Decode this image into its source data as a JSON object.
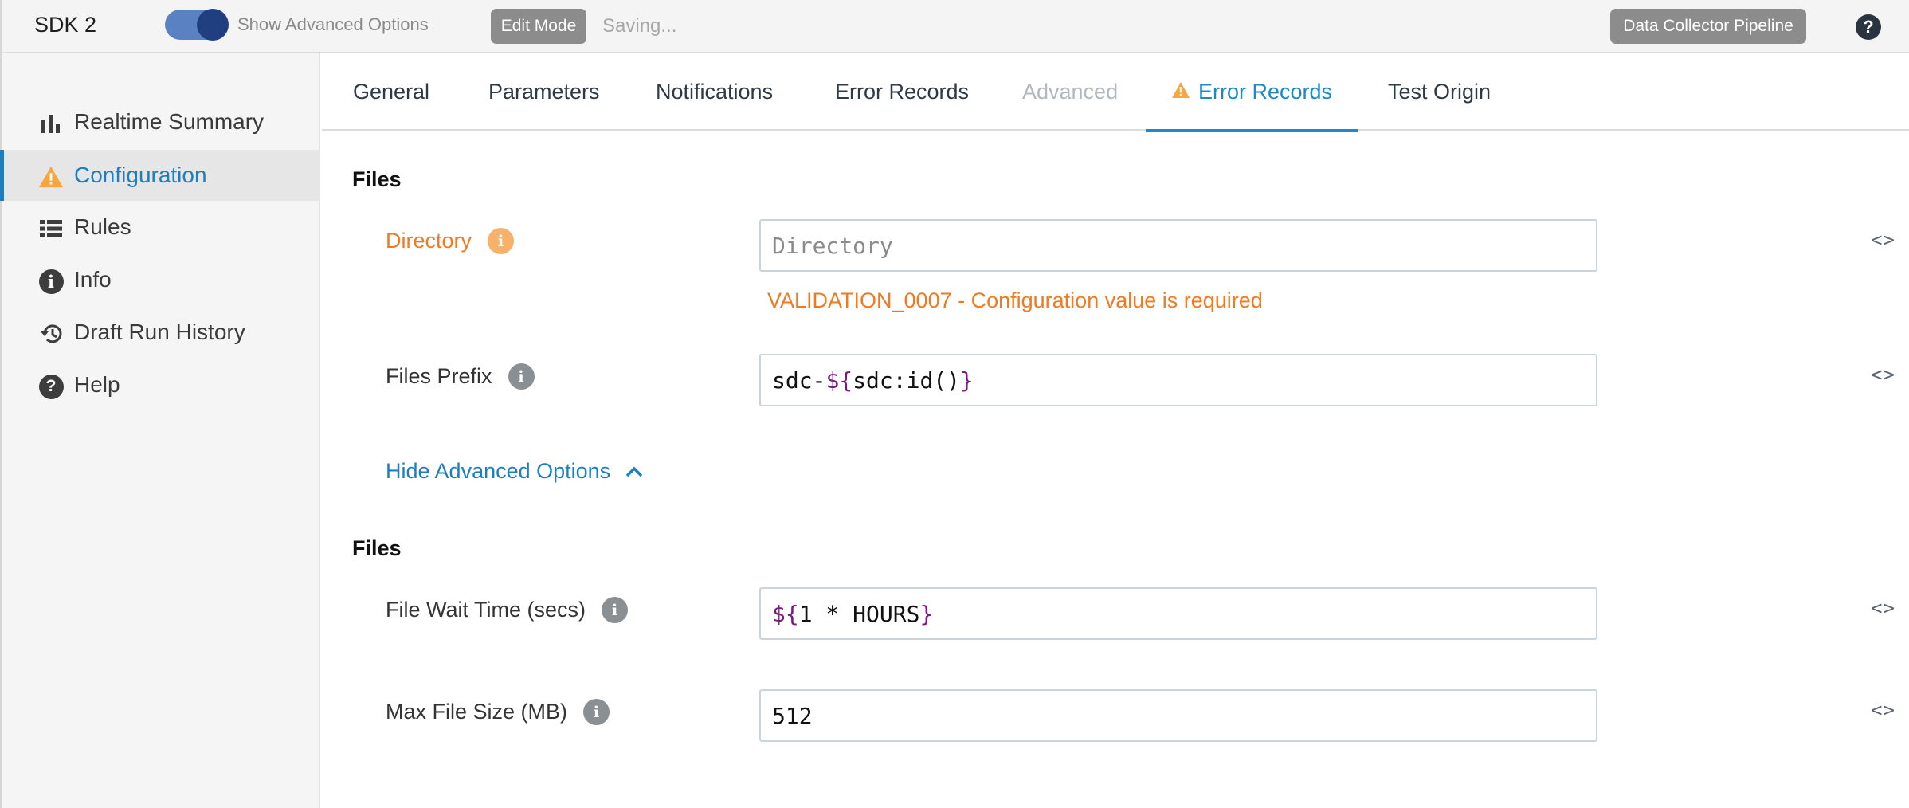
{
  "topbar": {
    "title": "SDK 2",
    "toggle_label": "Show Advanced Options",
    "edit_mode": "Edit Mode",
    "status": "Saving...",
    "pipeline_type": "Data Collector Pipeline",
    "help_glyph": "?"
  },
  "sidebar": {
    "items": [
      {
        "label": "Realtime Summary",
        "icon": "bar-chart-icon"
      },
      {
        "label": "Configuration",
        "icon": "warning-icon",
        "active": true
      },
      {
        "label": "Rules",
        "icon": "list-icon"
      },
      {
        "label": "Info",
        "icon": "info-icon"
      },
      {
        "label": "Draft Run History",
        "icon": "history-icon"
      },
      {
        "label": "Help",
        "icon": "help-icon"
      }
    ]
  },
  "tabs": [
    {
      "label": "General"
    },
    {
      "label": "Parameters"
    },
    {
      "label": "Notifications"
    },
    {
      "label": "Error Records"
    },
    {
      "label": "Advanced",
      "disabled": true
    },
    {
      "label": "Error Records",
      "active": true,
      "warning": true
    },
    {
      "label": "Test Origin"
    }
  ],
  "form": {
    "section1_title": "Files",
    "directory": {
      "label": "Directory",
      "placeholder": "Directory",
      "value": "",
      "validation": "VALIDATION_0007 - Configuration value is required"
    },
    "files_prefix": {
      "label": "Files Prefix",
      "value_prefix": "sdc-",
      "value_el_open": "${",
      "value_mid": "sdc:id()",
      "value_el_close": "}"
    },
    "advanced_toggle": "Hide Advanced Options",
    "section2_title": "Files",
    "file_wait_time": {
      "label": "File Wait Time (secs)",
      "value_el_open": "${",
      "value_mid": "1 * HOURS",
      "value_el_close": "}"
    },
    "max_file_size": {
      "label": "Max File Size (MB)",
      "value": "512"
    },
    "code_toggle_glyph": "<>",
    "info_glyph": "i"
  },
  "colors": {
    "accent": "#1e88c8",
    "error": "#f07a22",
    "el_purple": "#7a1a80",
    "pill_bg": "#8c8c8c"
  }
}
